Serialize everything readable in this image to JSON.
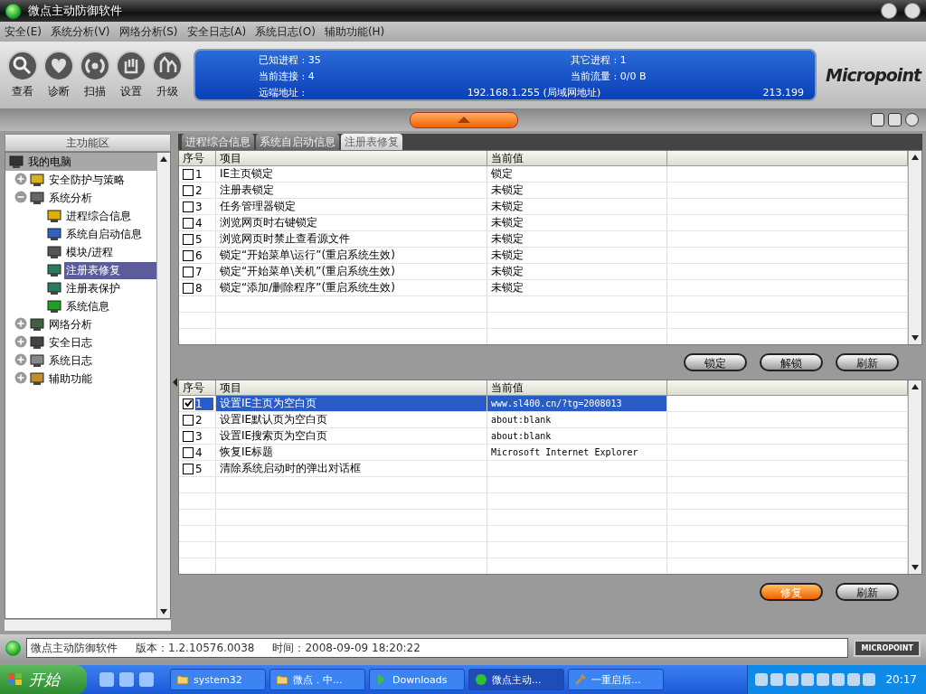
{
  "window": {
    "title": "微点主动防御软件"
  },
  "menu": [
    "安全(E)",
    "系统分析(V)",
    "网络分析(S)",
    "安全日志(A)",
    "系统日志(O)",
    "辅助功能(H)"
  ],
  "toolbar": [
    {
      "label": "查看",
      "kind": "search"
    },
    {
      "label": "诊断",
      "kind": "heart"
    },
    {
      "label": "扫描",
      "kind": "scan"
    },
    {
      "label": "设置",
      "kind": "hand"
    },
    {
      "label": "升级",
      "kind": "upgrade"
    }
  ],
  "info_panel": {
    "stats": [
      {
        "label": "已知进程 :",
        "value": "35"
      },
      {
        "label": "其它进程 :",
        "value": "1"
      },
      {
        "label": "当前连接 :",
        "value": "4"
      },
      {
        "label": "当前流量 :",
        "value": "0/0 B"
      }
    ],
    "remote": {
      "label": "远端地址 :",
      "address": "192.168.1.255 (局域网地址)",
      "extra": "213.199"
    }
  },
  "logo": "Micropoint",
  "sidebar": {
    "title": "主功能区",
    "tree": [
      {
        "label": "我的电脑",
        "selected": false,
        "children": [
          {
            "label": "安全防护与策略",
            "expanded": false,
            "selected": false
          },
          {
            "label": "系统分析",
            "expanded": true,
            "selected": false,
            "children": [
              {
                "label": "进程综合信息",
                "selected": false
              },
              {
                "label": "系统自启动信息",
                "selected": false
              },
              {
                "label": "模块/进程",
                "selected": false
              },
              {
                "label": "注册表修复",
                "selected": true
              },
              {
                "label": "注册表保护",
                "selected": false
              },
              {
                "label": "系统信息",
                "selected": false
              }
            ]
          },
          {
            "label": "网络分析",
            "expanded": false,
            "selected": false
          },
          {
            "label": "安全日志",
            "expanded": false,
            "selected": false
          },
          {
            "label": "系统日志",
            "expanded": false,
            "selected": false
          },
          {
            "label": "辅助功能",
            "expanded": false,
            "selected": false
          }
        ]
      }
    ]
  },
  "tabs": [
    {
      "label": "进程综合信息",
      "selected": false
    },
    {
      "label": "系统自启动信息",
      "selected": false
    },
    {
      "label": "注册表修复",
      "selected": true
    }
  ],
  "upper_table": {
    "columns": [
      "序号",
      "项目",
      "当前值"
    ],
    "rows": [
      {
        "no": "1",
        "item": "IE主页锁定",
        "value": "锁定",
        "checked": false
      },
      {
        "no": "2",
        "item": "注册表锁定",
        "value": "未锁定",
        "checked": false
      },
      {
        "no": "3",
        "item": "任务管理器锁定",
        "value": "未锁定",
        "checked": false
      },
      {
        "no": "4",
        "item": "浏览网页时右键锁定",
        "value": "未锁定",
        "checked": false
      },
      {
        "no": "5",
        "item": "浏览网页时禁止查看源文件",
        "value": "未锁定",
        "checked": false
      },
      {
        "no": "6",
        "item": "锁定“开始菜单\\运行”(重启系统生效)",
        "value": "未锁定",
        "checked": false
      },
      {
        "no": "7",
        "item": "锁定“开始菜单\\关机”(重启系统生效)",
        "value": "未锁定",
        "checked": false
      },
      {
        "no": "8",
        "item": "锁定“添加/删除程序”(重启系统生效)",
        "value": "未锁定",
        "checked": false
      }
    ]
  },
  "upper_buttons": [
    "锁定",
    "解锁",
    "刷新"
  ],
  "lower_table": {
    "columns": [
      "序号",
      "项目",
      "当前值"
    ],
    "rows": [
      {
        "no": "1",
        "item": "设置IE主页为空白页",
        "value": "www.sl400.cn/?tg=2008013",
        "checked": true,
        "selected": true
      },
      {
        "no": "2",
        "item": "设置IE默认页为空白页",
        "value": "about:blank",
        "checked": false,
        "selected": false
      },
      {
        "no": "3",
        "item": "设置IE搜索页为空白页",
        "value": "about:blank",
        "checked": false,
        "selected": false
      },
      {
        "no": "4",
        "item": "恢复IE标题",
        "value": "Microsoft Internet Explorer",
        "checked": false,
        "selected": false
      },
      {
        "no": "5",
        "item": "清除系统启动时的弹出对话框",
        "value": "",
        "checked": false,
        "selected": false
      }
    ]
  },
  "lower_buttons": [
    {
      "label": "修复",
      "kind": "primary"
    },
    {
      "label": "刷新",
      "kind": "normal"
    }
  ],
  "status_bar": {
    "app": "微点主动防御软件",
    "version": "版本：1.2.10576.0038",
    "time": "时间：2008-09-09 18:20:22",
    "badge": "MICROPOINT"
  },
  "taskbar": {
    "start": "开始",
    "tasks": [
      {
        "label": "system32",
        "selected": false
      },
      {
        "label": "微点．中...",
        "selected": false
      },
      {
        "label": "Downloads",
        "selected": false
      },
      {
        "label": "微点主动...",
        "selected": true
      },
      {
        "label": "一重启后...",
        "selected": false
      }
    ],
    "clock": "20:17"
  }
}
